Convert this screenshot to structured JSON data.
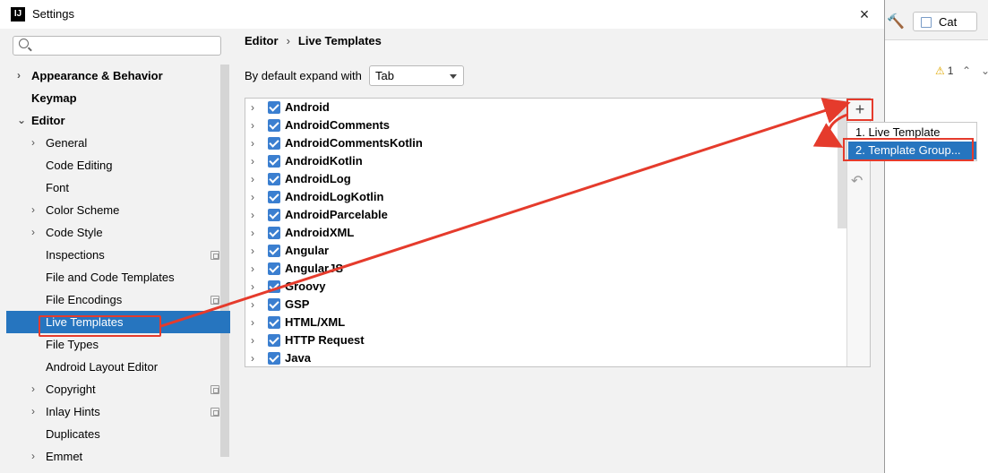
{
  "window": {
    "title": "Settings",
    "app_icon_text": "IJ",
    "close_glyph": "×"
  },
  "search": {
    "placeholder": "",
    "value": ""
  },
  "sidebar": {
    "items": [
      {
        "label": "Appearance & Behavior",
        "bold": true,
        "arrow": "›"
      },
      {
        "label": "Keymap",
        "bold": true
      },
      {
        "label": "Editor",
        "bold": true,
        "arrow": "⌄"
      },
      {
        "label": "General",
        "arrow": "›"
      },
      {
        "label": "Code Editing"
      },
      {
        "label": "Font"
      },
      {
        "label": "Color Scheme",
        "arrow": "›"
      },
      {
        "label": "Code Style",
        "arrow": "›"
      },
      {
        "label": "Inspections",
        "copy_icon": true
      },
      {
        "label": "File and Code Templates"
      },
      {
        "label": "File Encodings",
        "copy_icon": true
      },
      {
        "label": "Live Templates",
        "selected": true
      },
      {
        "label": "File Types"
      },
      {
        "label": "Android Layout Editor"
      },
      {
        "label": "Copyright",
        "arrow": "›",
        "copy_icon": true
      },
      {
        "label": "Inlay Hints",
        "arrow": "›",
        "copy_icon": true
      },
      {
        "label": "Duplicates"
      },
      {
        "label": "Emmet",
        "arrow": "›"
      }
    ]
  },
  "breadcrumb": {
    "parent": "Editor",
    "separator": "›",
    "current": "Live Templates"
  },
  "expand_setting": {
    "label": "By default expand with",
    "value": "Tab"
  },
  "template_groups": [
    "Android",
    "AndroidComments",
    "AndroidCommentsKotlin",
    "AndroidKotlin",
    "AndroidLog",
    "AndroidLogKotlin",
    "AndroidParcelable",
    "AndroidXML",
    "Angular",
    "AngularJS",
    "Groovy",
    "GSP",
    "HTML/XML",
    "HTTP Request",
    "Java"
  ],
  "toolbar": {
    "add_glyph": "+",
    "undo_glyph": "↶"
  },
  "add_menu": {
    "item1": "1. Live Template",
    "item2": "2. Template Group..."
  },
  "ide_background": {
    "run_config": "Cat",
    "warning_count": "1",
    "warning_glyph": "⚠",
    "up_glyph": "⌃",
    "down_glyph": "⌄",
    "hammer_glyph": "🔨"
  },
  "colors": {
    "selection": "#2675bf",
    "annotation": "#e53b2c",
    "checkbox": "#3b7fd0"
  },
  "icons": [
    "search-icon",
    "close-icon",
    "chevron-right-icon",
    "chevron-down-icon",
    "checkbox-checked-icon",
    "plus-icon",
    "undo-icon",
    "copy-icon",
    "warning-icon",
    "hammer-icon"
  ]
}
